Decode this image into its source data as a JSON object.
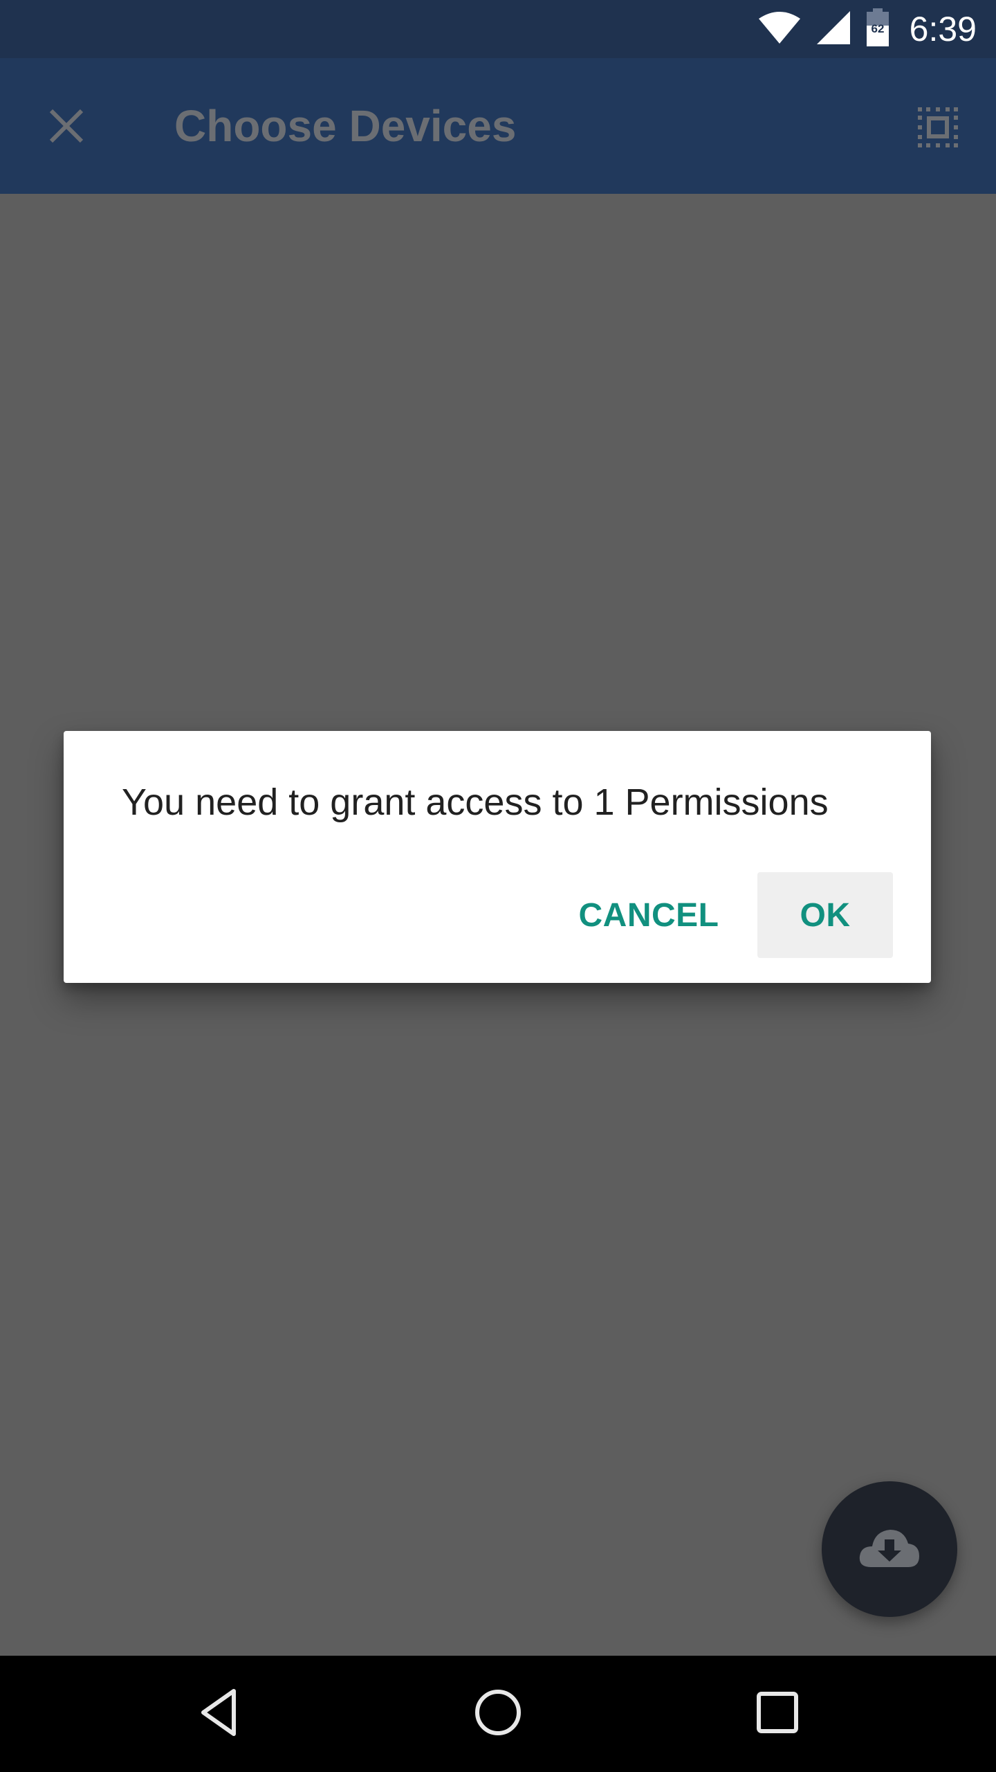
{
  "status_bar": {
    "time": "6:39",
    "battery_level": "62",
    "icons": [
      "wifi-icon",
      "cell-signal-icon",
      "battery-icon"
    ]
  },
  "toolbar": {
    "title": "Choose Devices",
    "close_icon": "close-icon",
    "select_all_icon": "select-all-icon"
  },
  "dialog": {
    "message": "You need to grant access to 1 Permissions",
    "cancel_label": "CANCEL",
    "ok_label": "OK"
  },
  "fab": {
    "icon": "cloud-download-icon"
  },
  "nav_bar": {
    "icons": [
      "back-icon",
      "home-icon",
      "recents-icon"
    ]
  },
  "colors": {
    "status_bar": "#1f324f",
    "toolbar": "#21395c",
    "scrim_background": "#5e5e5e",
    "accent": "#11907f",
    "fab": "#1e222a"
  }
}
